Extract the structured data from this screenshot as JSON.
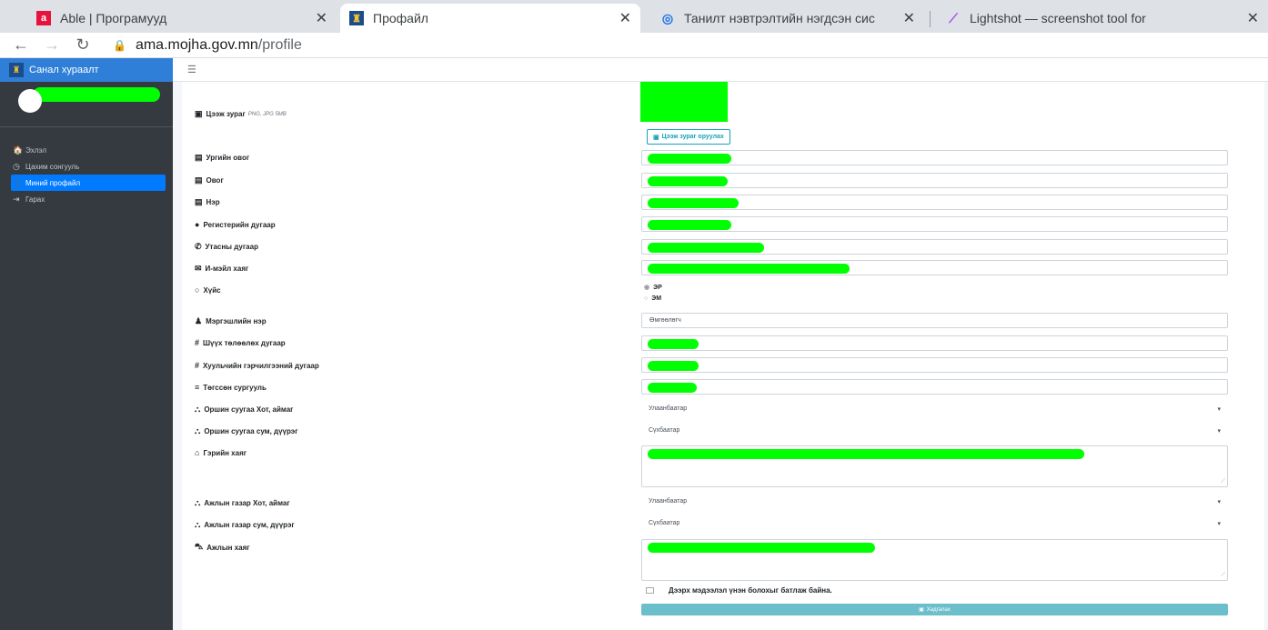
{
  "browser": {
    "tabs": [
      {
        "title": "Able | Програмууд",
        "favicon": "a"
      },
      {
        "title": "Профайл",
        "favicon": "emblem"
      },
      {
        "title": "Танилт нэвтрэлтийн нэгдсэн сис",
        "favicon": "globe"
      },
      {
        "title": "Lightshot — screenshot tool for",
        "favicon": "feather"
      }
    ],
    "url_host": "ama.mojha.gov.mn",
    "url_path": "/profile"
  },
  "sidebar": {
    "brand": "Санал хураалт",
    "items": [
      {
        "label": "Эхлэл",
        "icon": "home-icon",
        "glyph": "🏠"
      },
      {
        "label": "Цахим сонгууль",
        "icon": "dashboard-icon",
        "glyph": "◷"
      },
      {
        "label": "Миний профайл",
        "icon": "user-icon",
        "glyph": "👤"
      },
      {
        "label": "Гарах",
        "icon": "logout-icon",
        "glyph": "⇥"
      }
    ]
  },
  "form": {
    "photo_label": "Цээж зураг",
    "photo_hint": "PNG, JPG 5MB",
    "upload_button": "Цээж зураг оруулах",
    "labels": {
      "clan": "Ургийн овог",
      "surname": "Овог",
      "name": "Нэр",
      "register": "Регистерийн дугаар",
      "phone": "Утасны дугаар",
      "email": "И-мэйл хаяг",
      "gender": "Хүйс",
      "profession": "Мэргэшлийн нэр",
      "council": "Шүүх төлөөлөх дугаар",
      "license": "Хуульчийн гэрчилгээний дугаар",
      "school": "Төгссөн сургууль",
      "res_city": "Оршин суугаа Хот, аймаг",
      "res_district": "Оршин суугаа сум, дүүрэг",
      "home_address": "Гэрийн хаяг",
      "work_city": "Ажлын газар Хот, аймаг",
      "work_district": "Ажлын газар сум, дүүрэг",
      "work_address": "Ажлын хаяг"
    },
    "gender_options": [
      "ЭР",
      "ЭМ"
    ],
    "profession_value": "Өмгөөлөгч",
    "res_city_value": "Улаанбаатар",
    "res_district_value": "Сүхбаатар",
    "work_city_value": "Улаанбаатар",
    "work_district_value": "Сүхбаатар",
    "confirm_text": "Дээрх мэдээлэл үнэн болохыг батлаж байна.",
    "save_button": "Хадгалах"
  }
}
